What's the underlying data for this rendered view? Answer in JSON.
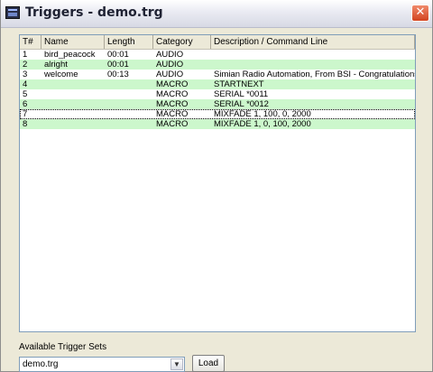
{
  "window": {
    "title": "Triggers - demo.trg",
    "close_glyph": "✕",
    "close_icon": "close-icon",
    "app_icon": "app-monitor-icon"
  },
  "table": {
    "columns": [
      "T#",
      "Name",
      "Length",
      "Category",
      "Description / Command Line"
    ],
    "rows": [
      {
        "num": "1",
        "name": "bird_peacock",
        "length": "00:01",
        "category": "AUDIO",
        "description": "",
        "bg": "white"
      },
      {
        "num": "2",
        "name": "alright",
        "length": "00:01",
        "category": "AUDIO",
        "description": "",
        "bg": "green"
      },
      {
        "num": "3",
        "name": "welcome",
        "length": "00:13",
        "category": "AUDIO",
        "description": "Simian Radio Automation, From BSI - Congratulations",
        "bg": "white"
      },
      {
        "num": "4",
        "name": "",
        "length": "",
        "category": "MACRO",
        "description": "STARTNEXT",
        "bg": "green"
      },
      {
        "num": "5",
        "name": "",
        "length": "",
        "category": "MACRO",
        "description": "SERIAL *0011",
        "bg": "white"
      },
      {
        "num": "6",
        "name": "",
        "length": "",
        "category": "MACRO",
        "description": "SERIAL *0012",
        "bg": "green"
      },
      {
        "num": "7",
        "name": "",
        "length": "",
        "category": "MACRO",
        "description": "MIXFADE 1, 100, 0, 2000",
        "bg": "white",
        "selected": true
      },
      {
        "num": "8",
        "name": "",
        "length": "",
        "category": "MACRO",
        "description": "MIXFADE 1, 0, 100, 2000",
        "bg": "green"
      }
    ],
    "colors": {
      "green_row": "#ccf7cc",
      "white_row": "#ffffff"
    }
  },
  "footer": {
    "sets_label": "Available Trigger Sets",
    "selected_set": "demo.trg",
    "dropdown_glyph": "▼",
    "load_label": "Load"
  }
}
